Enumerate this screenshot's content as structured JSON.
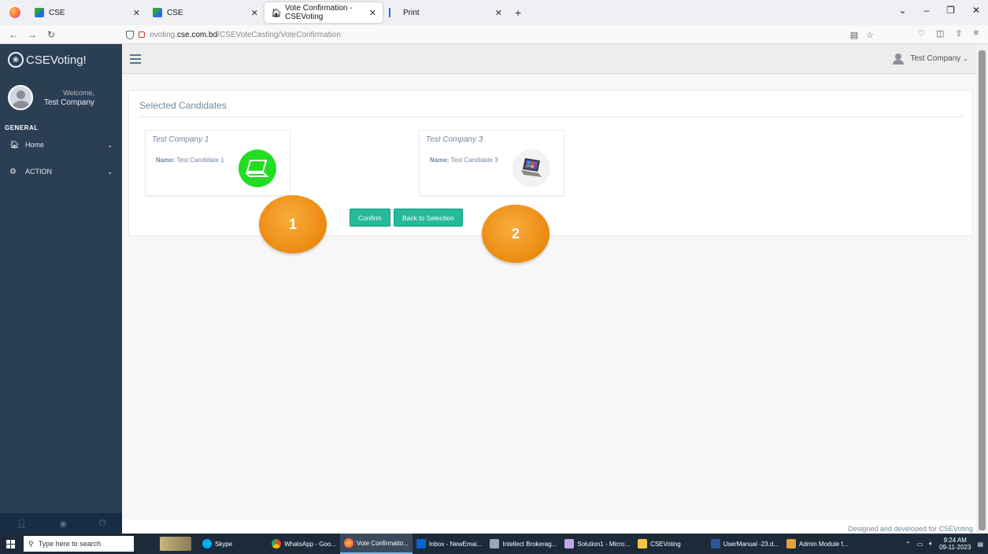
{
  "browser": {
    "tabs": [
      {
        "label": "CSE",
        "icon": "cse-favicon",
        "active": false
      },
      {
        "label": "CSE",
        "icon": "cse-favicon",
        "active": false
      },
      {
        "label": "Vote Confirmation - CSEVoting",
        "icon": "home-icon",
        "active": true
      },
      {
        "label": "Print",
        "icon": "print-favicon",
        "active": false
      }
    ],
    "url_prefix": "evoting.",
    "url_domain": "cse.com.bd",
    "url_path": "/CSEVoteCasting/VoteConfirmation"
  },
  "sidebar": {
    "brand": "CSEVoting!",
    "welcome": "Welcome,",
    "user_name": "Test Company",
    "section": "GENERAL",
    "items": [
      {
        "label": "Home",
        "icon": "home-icon"
      },
      {
        "label": "ACTION",
        "icon": "cogs-icon"
      }
    ]
  },
  "topnav": {
    "user_name": "Test Company"
  },
  "main": {
    "title": "Selected Candidates",
    "candidates": [
      {
        "company": "Test Company 1",
        "name_label": "Name:",
        "name": "Test Candidate 1",
        "symbol": "laptop-icon",
        "symbol_color": "#22dd22"
      },
      {
        "company": "Test Company 3",
        "name_label": "Name:",
        "name": "Test Candidate 3",
        "symbol": "laptop-photo-icon",
        "symbol_color": "#f2f2f2"
      }
    ],
    "confirm_label": "Confirm",
    "back_label": "Back to Selection",
    "badges": [
      "1",
      "2"
    ]
  },
  "footer": {
    "text": "Designed and developed for CSEVoting"
  },
  "taskbar": {
    "search_placeholder": "Type here to search",
    "apps": [
      "Skype",
      "WhatsApp - Goo...",
      "Vote Confirmatio...",
      "Inbox - NewEmai...",
      "Intellect Brokerag...",
      "Solution1 - Micro...",
      "CSEVoting",
      "UserManual -23.d...",
      "Admin Module f..."
    ],
    "time": "9:24 AM",
    "date": "09-11-2023"
  },
  "colors": {
    "sidebar": "#2a3f54",
    "button": "#26b99a",
    "badge": "#ec8a10"
  }
}
